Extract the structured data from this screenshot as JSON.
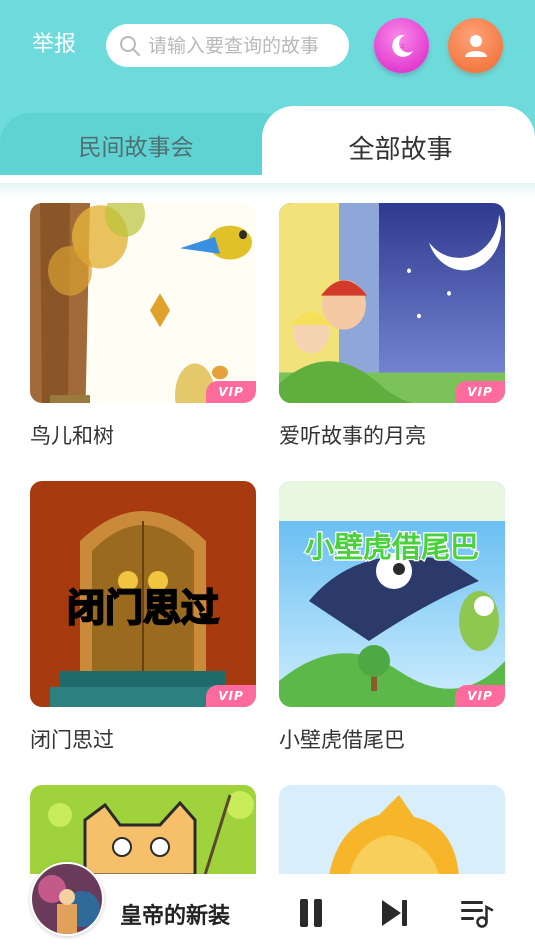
{
  "header": {
    "report_label": "举报",
    "search_placeholder": "请输入要查询的故事",
    "night_mode_icon": "moon-icon",
    "profile_icon": "user-icon",
    "background_color": "#6ddbdc"
  },
  "tabs": [
    {
      "label": "民间故事会",
      "active": false
    },
    {
      "label": "全部故事",
      "active": true
    }
  ],
  "stories": [
    {
      "title": "鸟儿和树",
      "badge": "VIP"
    },
    {
      "title": "爱听故事的月亮",
      "badge": "VIP"
    },
    {
      "title": "闭门思过",
      "badge": "VIP",
      "cover_text": "闭门思过"
    },
    {
      "title": "小壁虎借尾巴",
      "badge": "VIP",
      "cover_text": "小壁虎借尾巴"
    },
    {
      "title": "",
      "badge": ""
    },
    {
      "title": "",
      "badge": ""
    }
  ],
  "player": {
    "now_playing": "皇帝的新装",
    "state": "playing",
    "pause_icon": "pause-icon",
    "next_icon": "skip-next-icon",
    "playlist_icon": "playlist-icon"
  },
  "colors": {
    "accent": "#6ddbdc",
    "vip_badge": "#ff6b9d",
    "night_button": "#e33ed0",
    "profile_button": "#f47a43"
  }
}
